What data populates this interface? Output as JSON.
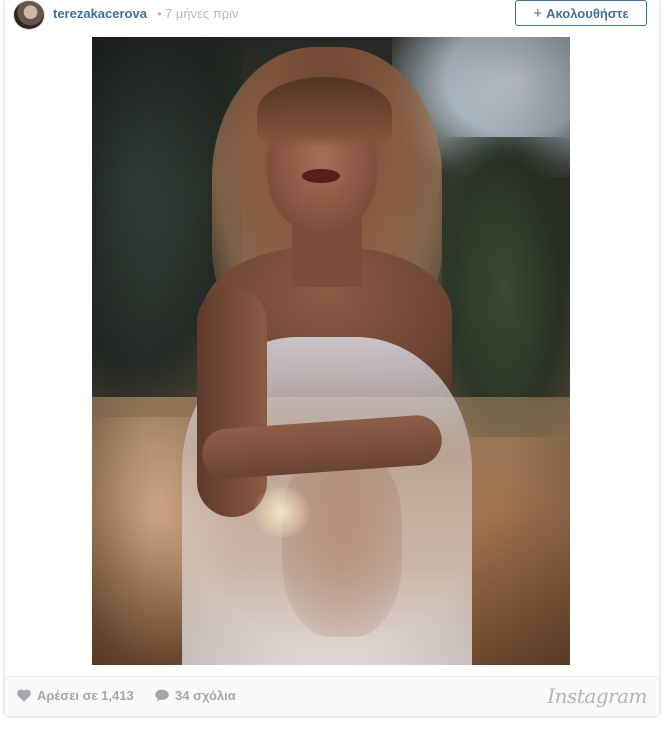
{
  "header": {
    "username": "terezakacerova",
    "separator": "•",
    "timestamp": "7 μήνες πριν",
    "follow_label": "Ακολουθήστε",
    "follow_icon": "+"
  },
  "footer": {
    "likes_label": "Αρέσει σε 1,413",
    "comments_label": "34 σχόλια",
    "brand": "Instagram"
  },
  "colors": {
    "link": "#3f729b",
    "muted": "#a5a7aa",
    "timestamp": "#bbbbbb"
  },
  "icons": {
    "like": "heart-icon",
    "comment": "comment-bubble-icon",
    "follow": "plus-icon"
  }
}
